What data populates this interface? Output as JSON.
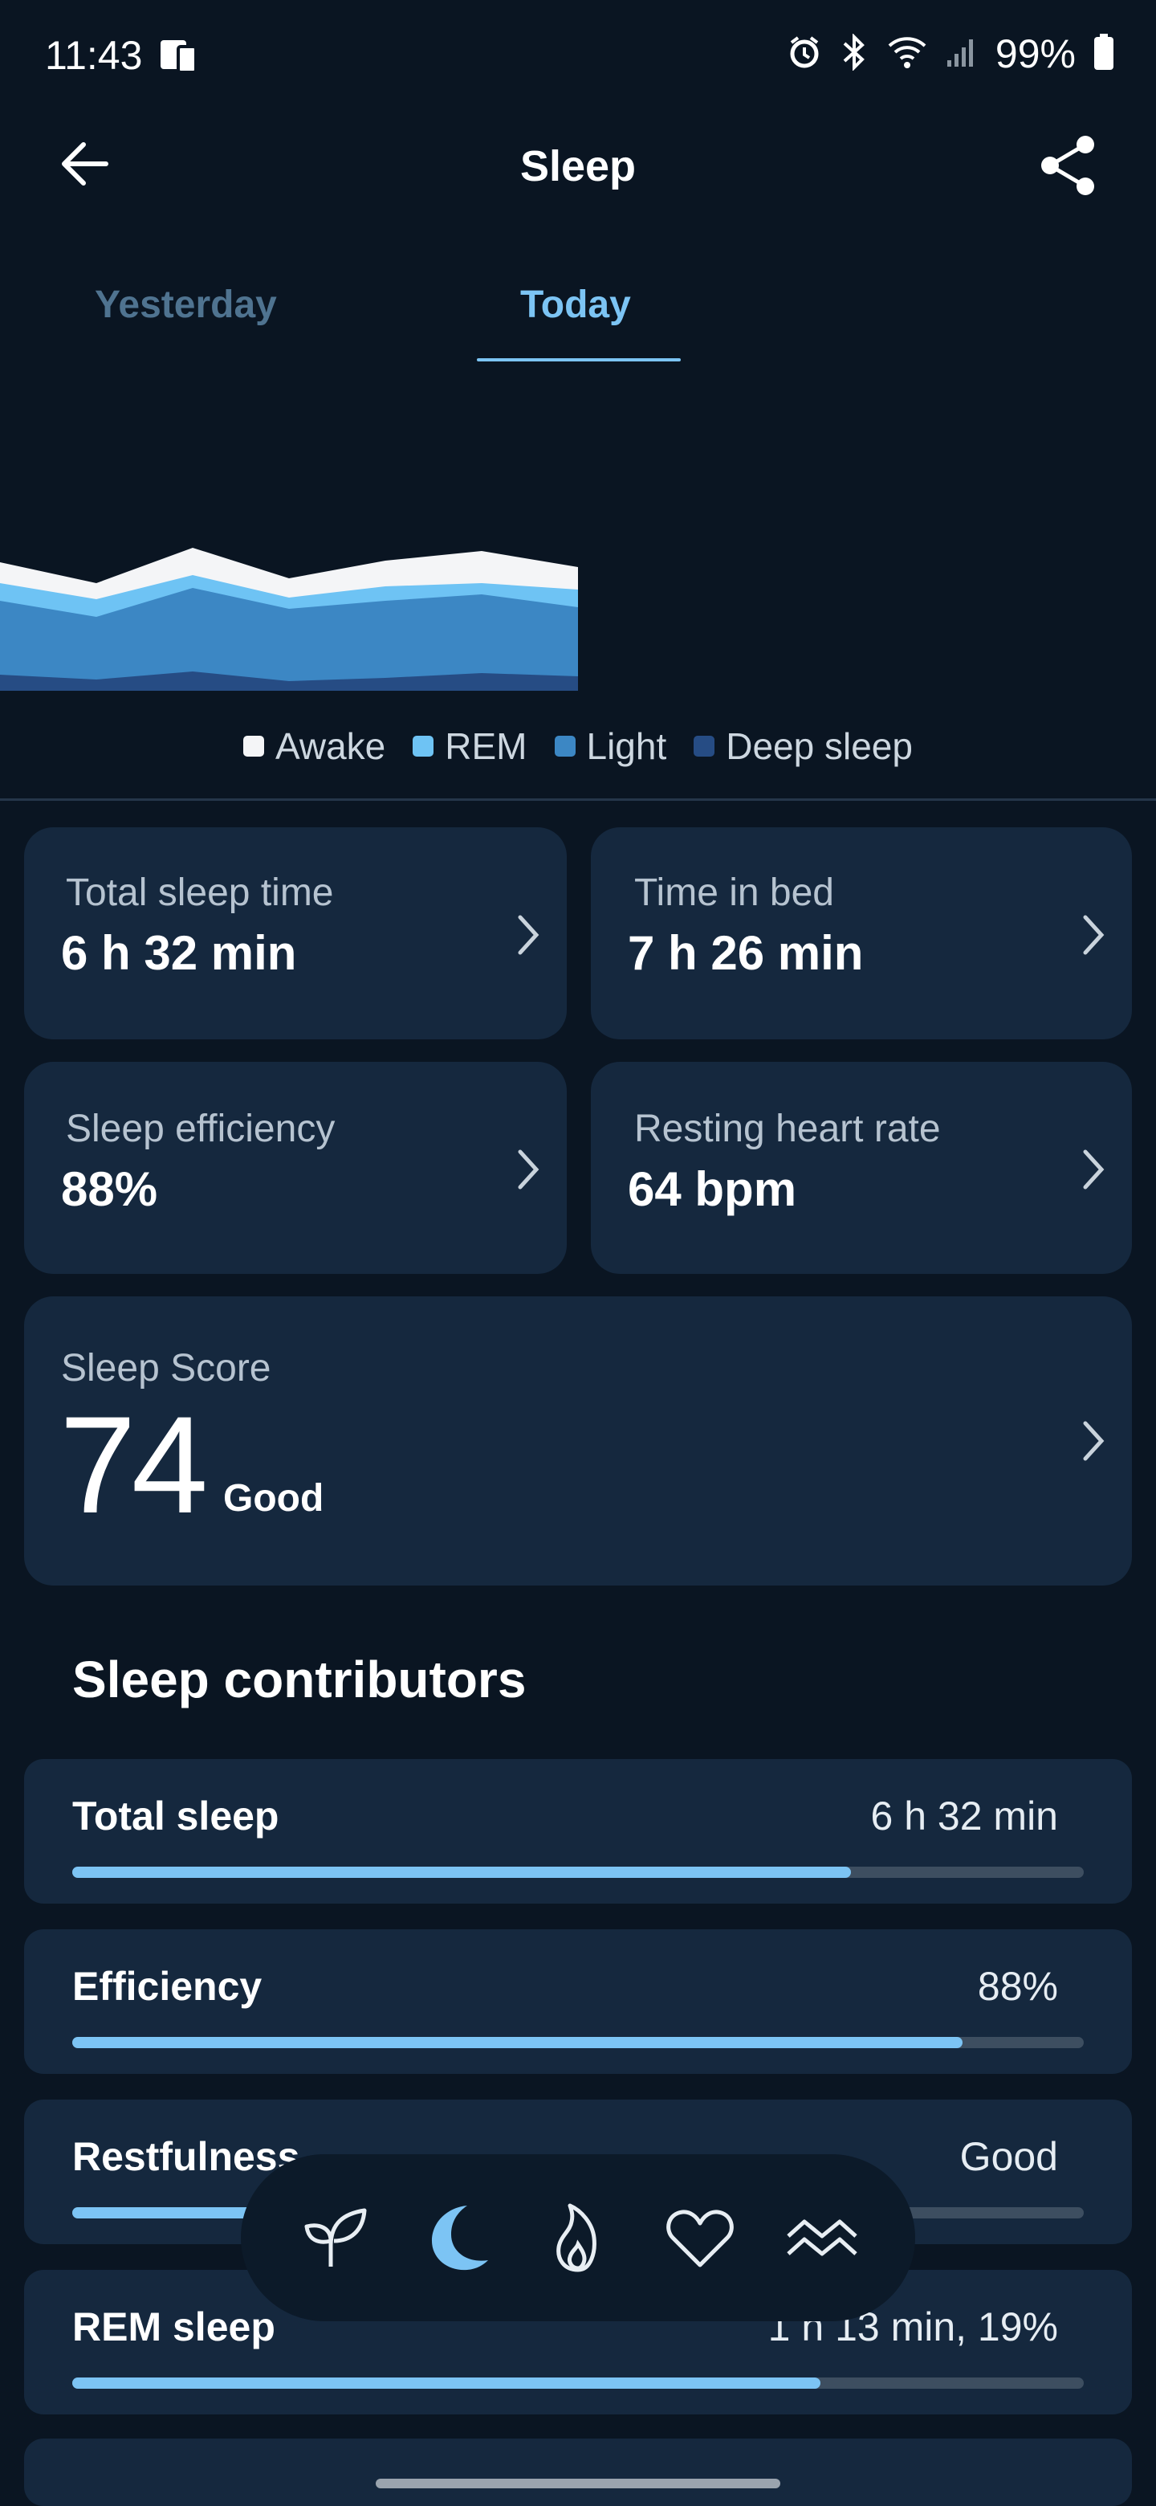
{
  "status_bar": {
    "time": "11:43",
    "battery": "99%"
  },
  "header": {
    "title": "Sleep"
  },
  "tabs": [
    {
      "label": "Yesterday",
      "selected": false
    },
    {
      "label": "Today",
      "selected": true
    }
  ],
  "chart_data": {
    "type": "area",
    "series": [
      {
        "name": "Awake",
        "color": "#f4f5f7"
      },
      {
        "name": "REM",
        "color": "#6ec3f4"
      },
      {
        "name": "Light",
        "color": "#3c87c4"
      },
      {
        "name": "Deep sleep",
        "color": "#264c84"
      }
    ]
  },
  "legend": [
    {
      "label": "Awake",
      "color": "#f4f5f7"
    },
    {
      "label": "REM",
      "color": "#6ec3f4"
    },
    {
      "label": "Light",
      "color": "#3c87c4"
    },
    {
      "label": "Deep sleep",
      "color": "#264c84"
    }
  ],
  "metrics": {
    "total_sleep_time": {
      "label": "Total sleep time",
      "value": "6 h 32 min"
    },
    "time_in_bed": {
      "label": "Time in bed",
      "value": "7 h 26 min"
    },
    "sleep_efficiency": {
      "label": "Sleep efficiency",
      "value": "88%"
    },
    "resting_heart_rate": {
      "label": "Resting heart rate",
      "value": "64 bpm"
    }
  },
  "sleep_score": {
    "label": "Sleep Score",
    "value": "74",
    "rating": "Good"
  },
  "contributors": {
    "title": "Sleep contributors",
    "items": [
      {
        "label": "Total sleep",
        "value": "6 h 32 min",
        "progress": 0.77
      },
      {
        "label": "Efficiency",
        "value": "88%",
        "progress": 0.88
      },
      {
        "label": "Restfulness",
        "value": "Good",
        "progress": 0.6
      },
      {
        "label": "REM sleep",
        "value": "1 h 13 min, 19%",
        "progress": 0.74
      }
    ]
  },
  "bottom_nav": [
    {
      "icon": "sprout-icon",
      "selected": false
    },
    {
      "icon": "moon-icon",
      "selected": true
    },
    {
      "icon": "flame-icon",
      "selected": false
    },
    {
      "icon": "heart-icon",
      "selected": false
    },
    {
      "icon": "waves-icon",
      "selected": false
    }
  ],
  "colors": {
    "background": "#0a1522",
    "card": "#15283e",
    "accent": "#7cc4f4"
  }
}
